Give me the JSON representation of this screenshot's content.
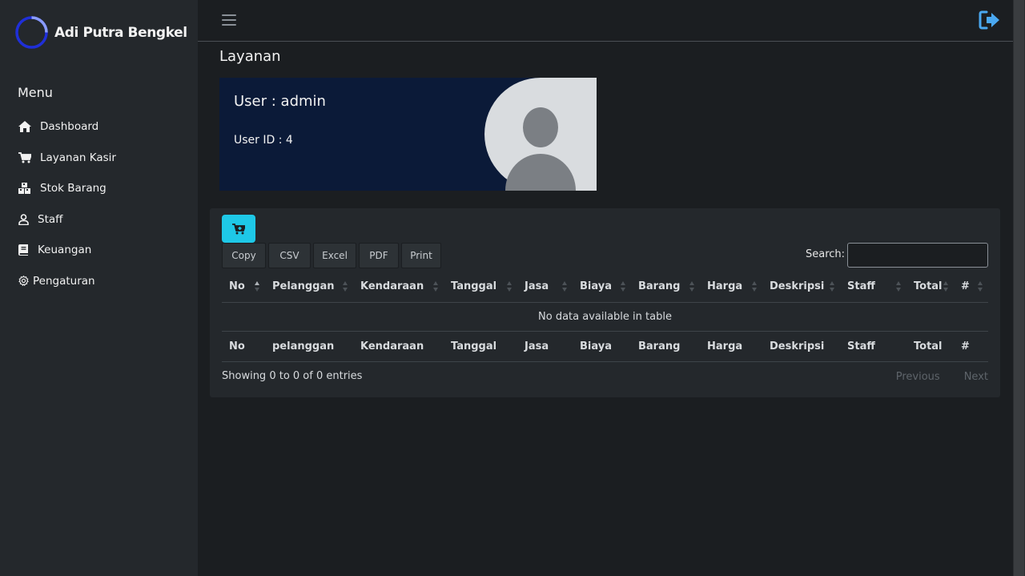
{
  "sidebar": {
    "brand": "Adi Putra Bengkel",
    "menu_title": "Menu",
    "items": [
      {
        "label": "Dashboard",
        "icon": "home-icon"
      },
      {
        "label": "Layanan Kasir",
        "icon": "cart-icon"
      },
      {
        "label": "Stok Barang",
        "icon": "boxes-icon"
      },
      {
        "label": "Staff",
        "icon": "user-icon"
      },
      {
        "label": "Keuangan",
        "icon": "book-icon"
      },
      {
        "label": "Pengaturan",
        "icon": "gear-icon"
      }
    ]
  },
  "page": {
    "title": "Layanan"
  },
  "user_card": {
    "name": "User : admin",
    "id": "User ID : 4"
  },
  "table": {
    "export_buttons": [
      "Copy",
      "CSV",
      "Excel",
      "PDF",
      "Print"
    ],
    "search_label": "Search:",
    "search_value": "",
    "headers": [
      "No",
      "Pelanggan",
      "Kendaraan",
      "Tanggal",
      "Jasa",
      "Biaya",
      "Barang",
      "Harga",
      "Deskripsi",
      "Staff",
      "Total",
      "#"
    ],
    "empty_message": "No data available in table",
    "footers": [
      "No",
      "pelanggan",
      "Kendaraan",
      "Tanggal",
      "Jasa",
      "Biaya",
      "Barang",
      "Harga",
      "Deskripsi",
      "Staff",
      "Total",
      "#"
    ],
    "info": "Showing 0 to 0 of 0 entries",
    "pagination": {
      "previous": "Previous",
      "next": "Next"
    }
  },
  "colors": {
    "accent": "#1ec8e7",
    "user_card_bg": "#0b1a38",
    "logout_icon": "#4aa8f0"
  }
}
